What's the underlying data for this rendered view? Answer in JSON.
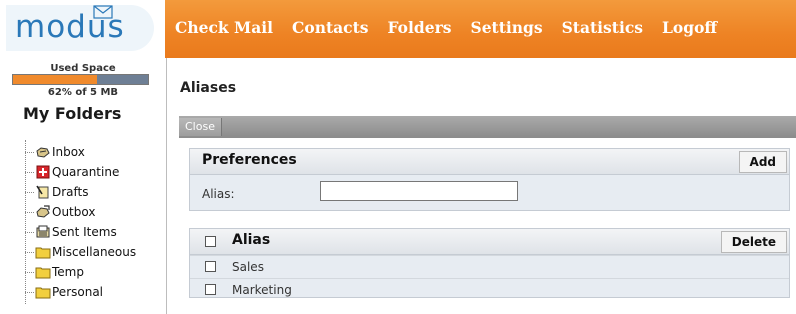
{
  "logo": {
    "text": "modus"
  },
  "nav": [
    "Check Mail",
    "Contacts",
    "Folders",
    "Settings",
    "Statistics",
    "Logoff"
  ],
  "sidebar": {
    "used_space_label": "Used Space",
    "quota_fraction": 0.62,
    "quota_text": "62% of 5 MB",
    "my_folders": "My Folders",
    "folders": [
      {
        "label": "Inbox",
        "icon": "inbox-icon"
      },
      {
        "label": "Quarantine",
        "icon": "quarantine-icon"
      },
      {
        "label": "Drafts",
        "icon": "drafts-icon"
      },
      {
        "label": "Outbox",
        "icon": "outbox-icon"
      },
      {
        "label": "Sent Items",
        "icon": "sent-items-icon"
      },
      {
        "label": "Miscellaneous",
        "icon": "folder-icon"
      },
      {
        "label": "Temp",
        "icon": "folder-icon"
      },
      {
        "label": "Personal",
        "icon": "folder-icon"
      }
    ]
  },
  "main": {
    "title": "Aliases",
    "close_label": "Close",
    "preferences": {
      "title": "Preferences",
      "add_label": "Add",
      "alias_label": "Alias:",
      "alias_value": ""
    },
    "alias_list": {
      "header": "Alias",
      "delete_label": "Delete",
      "rows": [
        "Sales",
        "Marketing"
      ]
    }
  },
  "colors": {
    "header_orange": "#ee8324",
    "logo_blue": "#2a78b8",
    "quota_fill": "#f08a2c"
  }
}
